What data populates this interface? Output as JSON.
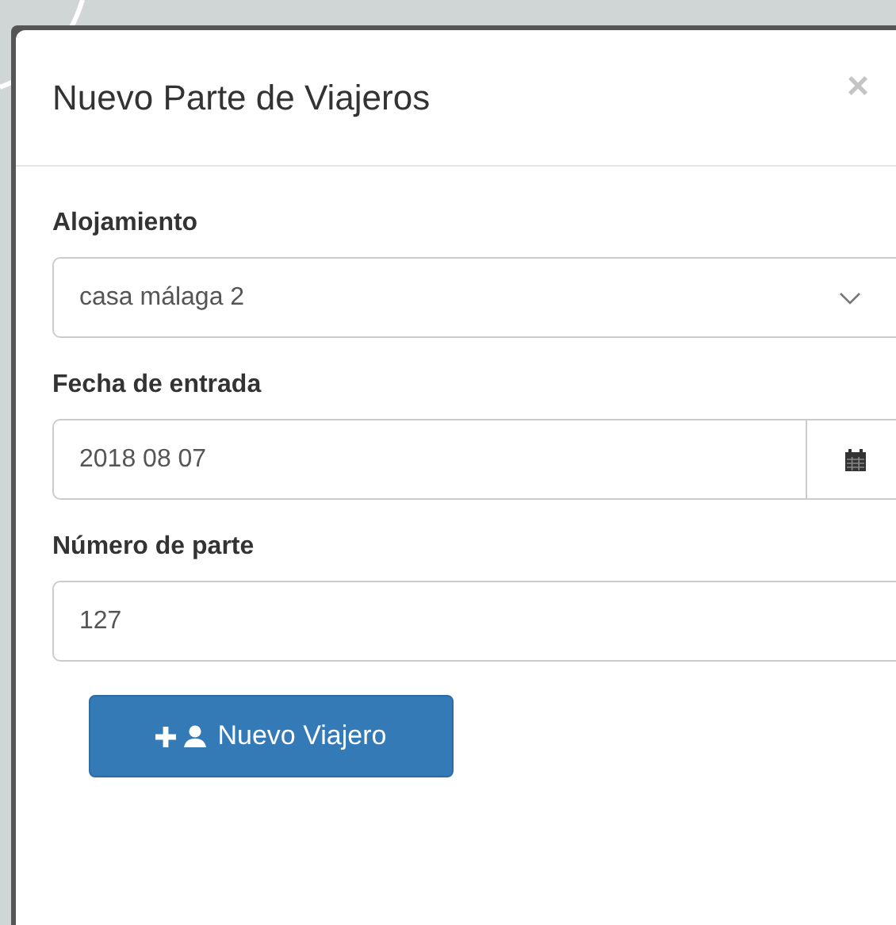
{
  "dialog": {
    "title": "Nuevo Parte de Viajeros",
    "close": "×"
  },
  "fields": [
    {
      "kind": "select",
      "label": "Alojamiento",
      "value": "casa málaga 2"
    },
    {
      "kind": "date",
      "label": "Fecha de entrada",
      "value": "2018 08 07"
    },
    {
      "kind": "text",
      "label": "Número de parte",
      "value": "127"
    }
  ],
  "button": {
    "label": "Nuevo Viajero"
  }
}
